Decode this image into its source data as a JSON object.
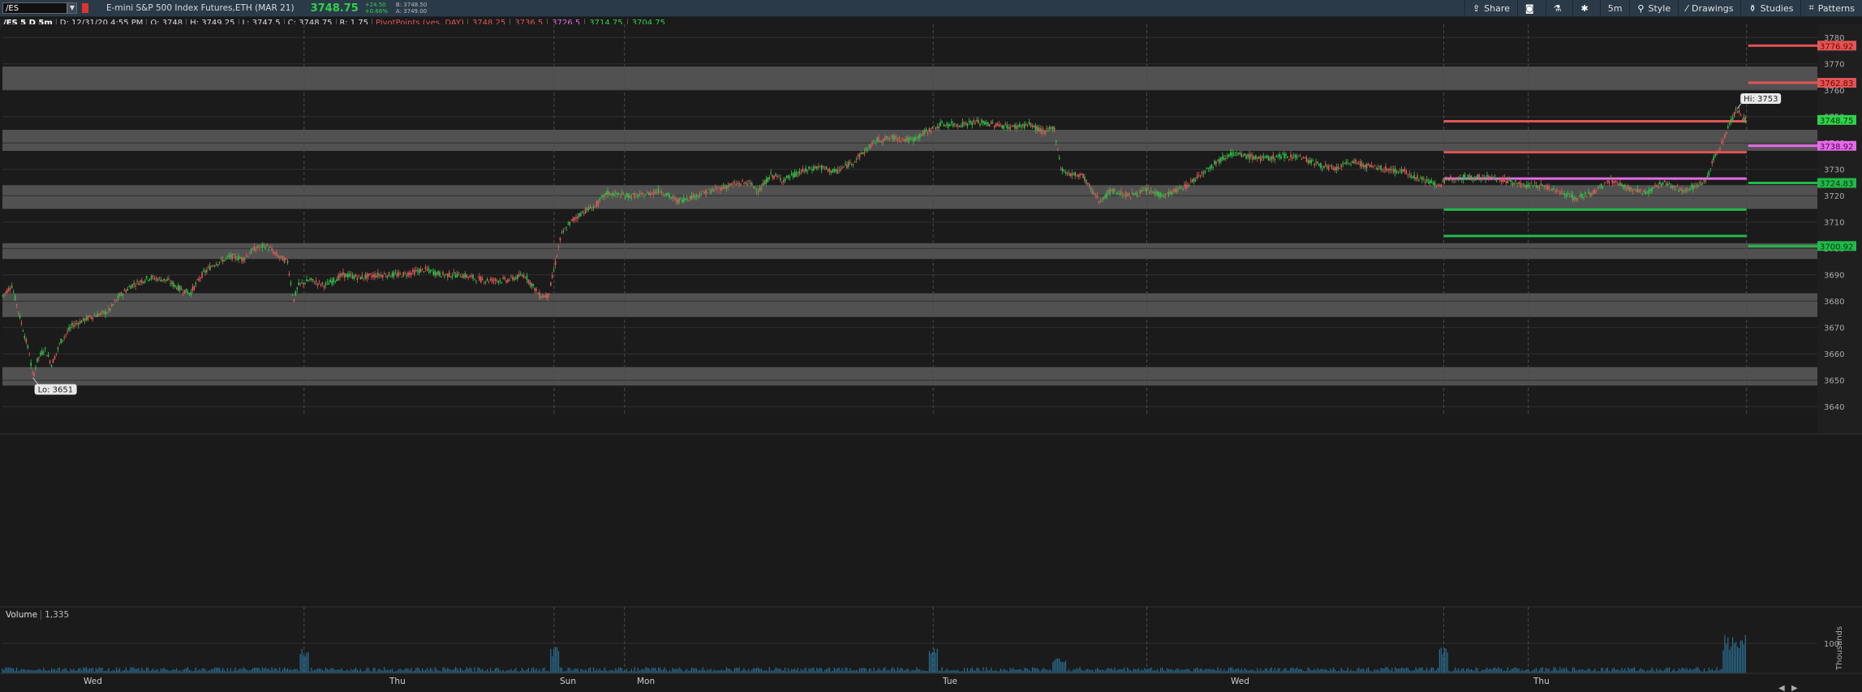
{
  "toolbar": {
    "symbol": "/ES",
    "description": "E-mini S&P 500 Index Futures,ETH (MAR 21)",
    "last": "3748.75",
    "change_abs": "+24.50",
    "change_pct": "+0.66%",
    "bid": "B: 3748.50",
    "ask": "A: 3749.00",
    "share": "Share",
    "interval": "5m",
    "style": "Style",
    "drawings": "Drawings",
    "studies": "Studies",
    "patterns": "Patterns"
  },
  "infobar": {
    "title": "/ES 5 D 5m",
    "date": "D: 12/31/20 4:55 PM",
    "open": "O: 3748",
    "high": "H: 3749.25",
    "low": "L: 3747.5",
    "close": "C: 3748.75",
    "range": "R: 1.75",
    "study": "PivotPoints (yes, DAY)",
    "pivots": [
      {
        "value": "3748.25",
        "color": "#e05555"
      },
      {
        "value": "3736.5",
        "color": "#e05555"
      },
      {
        "value": "3726.5",
        "color": "#e46be6"
      },
      {
        "value": "3714.75",
        "color": "#31d14a"
      },
      {
        "value": "3704.75",
        "color": "#31d14a"
      }
    ]
  },
  "volume": {
    "label": "Volume",
    "value": "1,335",
    "axis_label": "100",
    "axis_side_label": "Thousands"
  },
  "colors": {
    "up": "#31c14a",
    "down": "#e05a5a",
    "r_line": "#e05555",
    "pp_line": "#e46be6",
    "s_line": "#22b84a",
    "zone": "#5a5a5a"
  },
  "chart_data": {
    "type": "candlestick",
    "interval": "5m",
    "ylim": [
      3637,
      3785
    ],
    "y_ticks": [
      3640,
      3650,
      3660,
      3670,
      3680,
      3690,
      3700,
      3710,
      3720,
      3730,
      3740,
      3750,
      3760,
      3770,
      3780
    ],
    "x_day_labels": [
      "Wed",
      "Thu",
      "Sun",
      "Mon",
      "Tue",
      "Wed",
      "Thu"
    ],
    "gray_zones": [
      [
        3760,
        3769
      ],
      [
        3737,
        3745
      ],
      [
        3715,
        3724
      ],
      [
        3696,
        3702
      ],
      [
        3674,
        3683
      ],
      [
        3648,
        3655
      ]
    ],
    "pivot_segments": [
      {
        "value": 3748.25,
        "kind": "r"
      },
      {
        "value": 3736.5,
        "kind": "r"
      },
      {
        "value": 3726.5,
        "kind": "pp"
      },
      {
        "value": 3714.75,
        "kind": "s"
      },
      {
        "value": 3704.75,
        "kind": "s"
      }
    ],
    "next_day_levels": [
      {
        "value": 3776.92,
        "label": "3776.92",
        "kind": "r"
      },
      {
        "value": 3762.83,
        "label": "3762.83",
        "kind": "r"
      },
      {
        "value": 3738.92,
        "label": "3738.92",
        "kind": "pp"
      },
      {
        "value": 3724.83,
        "label": "3724.83",
        "kind": "s"
      },
      {
        "value": 3700.92,
        "label": "3700.92",
        "kind": "s"
      }
    ],
    "last_price": {
      "value": 3748.75,
      "label": "3748.75"
    },
    "high_marker": {
      "label": "Hi: 3753",
      "value": 3753
    },
    "low_marker": {
      "label": "Lo: 3651",
      "value": 3651
    },
    "price_path": [
      [
        0,
        3682
      ],
      [
        8,
        3686
      ],
      [
        16,
        3672
      ],
      [
        23,
        3660
      ],
      [
        26,
        3651
      ],
      [
        30,
        3658
      ],
      [
        36,
        3662
      ],
      [
        42,
        3656
      ],
      [
        50,
        3665
      ],
      [
        60,
        3671
      ],
      [
        75,
        3674
      ],
      [
        90,
        3676
      ],
      [
        100,
        3682
      ],
      [
        110,
        3686
      ],
      [
        125,
        3689
      ],
      [
        140,
        3688
      ],
      [
        150,
        3685
      ],
      [
        160,
        3683
      ],
      [
        170,
        3690
      ],
      [
        180,
        3694
      ],
      [
        195,
        3697
      ],
      [
        205,
        3696
      ],
      [
        215,
        3700
      ],
      [
        225,
        3701
      ],
      [
        235,
        3697
      ],
      [
        243,
        3695
      ],
      [
        248,
        3680
      ],
      [
        252,
        3686
      ],
      [
        262,
        3688
      ],
      [
        275,
        3686
      ],
      [
        290,
        3690
      ],
      [
        305,
        3689
      ],
      [
        320,
        3690
      ],
      [
        340,
        3690
      ],
      [
        360,
        3692
      ],
      [
        375,
        3690
      ],
      [
        390,
        3690
      ],
      [
        410,
        3688
      ],
      [
        430,
        3688
      ],
      [
        445,
        3690
      ],
      [
        458,
        3682
      ],
      [
        465,
        3682
      ],
      [
        470,
        3692
      ],
      [
        476,
        3705
      ],
      [
        484,
        3710
      ],
      [
        495,
        3714
      ],
      [
        505,
        3716
      ],
      [
        515,
        3721
      ],
      [
        530,
        3720
      ],
      [
        545,
        3720
      ],
      [
        560,
        3722
      ],
      [
        575,
        3718
      ],
      [
        590,
        3720
      ],
      [
        605,
        3722
      ],
      [
        620,
        3724
      ],
      [
        635,
        3725
      ],
      [
        645,
        3722
      ],
      [
        655,
        3728
      ],
      [
        665,
        3726
      ],
      [
        680,
        3729
      ],
      [
        695,
        3731
      ],
      [
        710,
        3729
      ],
      [
        725,
        3733
      ],
      [
        735,
        3737
      ],
      [
        745,
        3741
      ],
      [
        760,
        3742
      ],
      [
        775,
        3741
      ],
      [
        790,
        3745
      ],
      [
        800,
        3747
      ],
      [
        815,
        3747
      ],
      [
        830,
        3748
      ],
      [
        845,
        3747
      ],
      [
        860,
        3746
      ],
      [
        875,
        3747
      ],
      [
        888,
        3744
      ],
      [
        896,
        3746
      ],
      [
        902,
        3730
      ],
      [
        910,
        3728
      ],
      [
        920,
        3728
      ],
      [
        928,
        3722
      ],
      [
        935,
        3718
      ],
      [
        945,
        3722
      ],
      [
        960,
        3720
      ],
      [
        975,
        3722
      ],
      [
        990,
        3720
      ],
      [
        1000,
        3722
      ],
      [
        1010,
        3724
      ],
      [
        1020,
        3728
      ],
      [
        1032,
        3732
      ],
      [
        1045,
        3736
      ],
      [
        1060,
        3735
      ],
      [
        1075,
        3734
      ],
      [
        1090,
        3735
      ],
      [
        1105,
        3735
      ],
      [
        1120,
        3732
      ],
      [
        1135,
        3730
      ],
      [
        1150,
        3733
      ],
      [
        1165,
        3731
      ],
      [
        1180,
        3730
      ],
      [
        1195,
        3729
      ],
      [
        1210,
        3726
      ],
      [
        1225,
        3724
      ],
      [
        1235,
        3727
      ],
      [
        1250,
        3727
      ],
      [
        1265,
        3727
      ],
      [
        1280,
        3726
      ],
      [
        1295,
        3724
      ],
      [
        1310,
        3724
      ],
      [
        1325,
        3722
      ],
      [
        1340,
        3719
      ],
      [
        1355,
        3721
      ],
      [
        1370,
        3726
      ],
      [
        1385,
        3723
      ],
      [
        1400,
        3721
      ],
      [
        1415,
        3725
      ],
      [
        1430,
        3722
      ],
      [
        1445,
        3724
      ],
      [
        1452,
        3726
      ],
      [
        1458,
        3734
      ],
      [
        1465,
        3740
      ],
      [
        1472,
        3748
      ],
      [
        1478,
        3753
      ],
      [
        1483,
        3749
      ],
      [
        1486,
        3748.75
      ]
    ]
  }
}
